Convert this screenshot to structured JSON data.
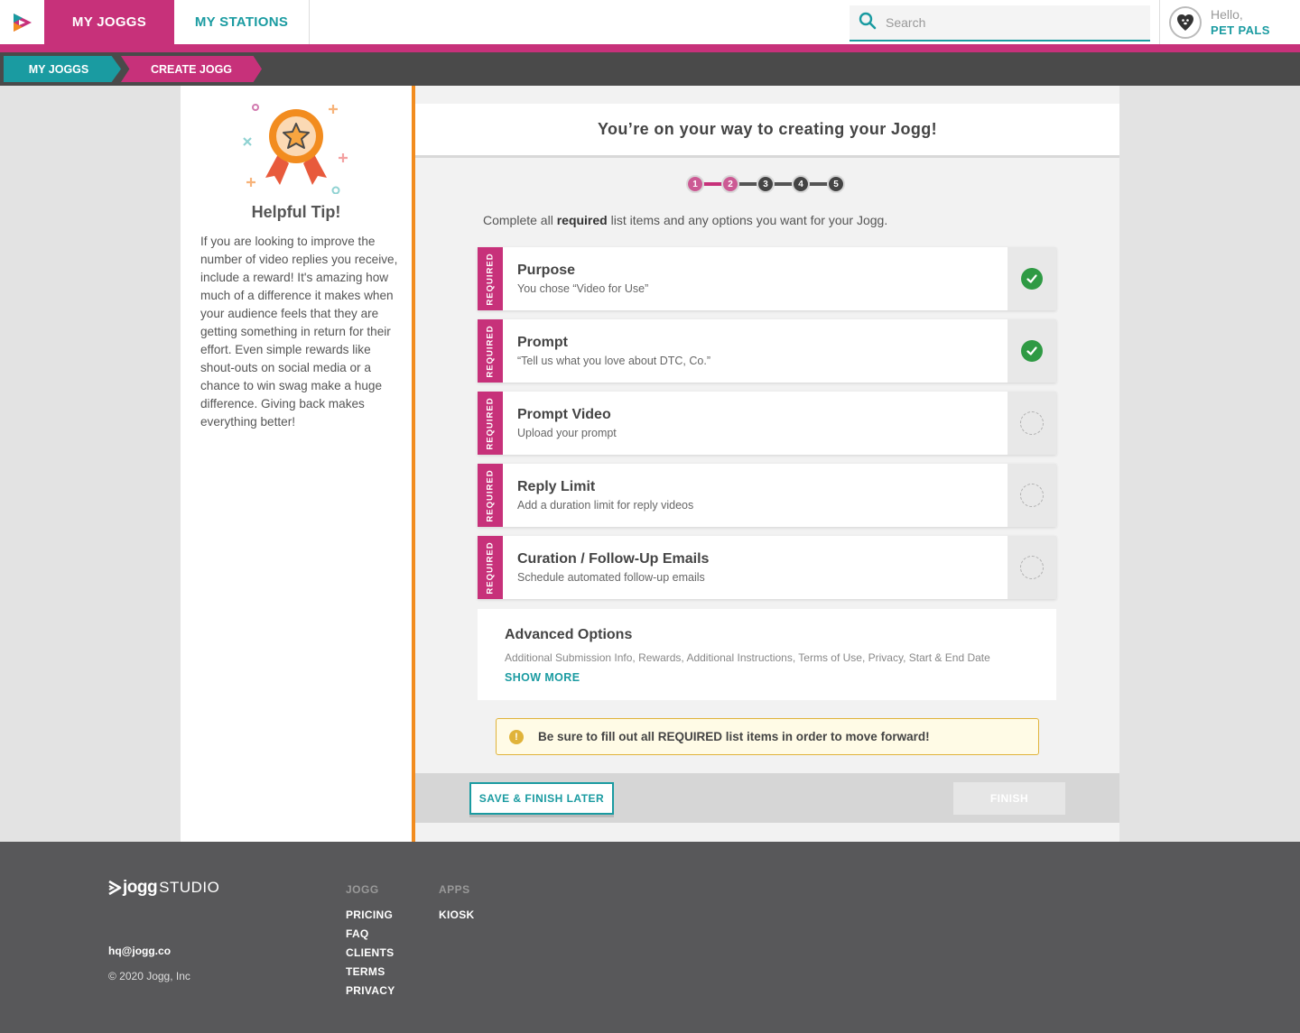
{
  "nav": {
    "tabs": [
      {
        "label": "MY JOGGS",
        "active": true
      },
      {
        "label": "MY STATIONS",
        "active": false
      }
    ],
    "search_placeholder": "Search",
    "user": {
      "greeting": "Hello,",
      "name": "PET PALS"
    }
  },
  "breadcrumb": [
    "MY JOGGS",
    "CREATE JOGG"
  ],
  "tip": {
    "title": "Helpful Tip!",
    "body": "If you are looking to improve the number of video replies you receive, include a reward! It's amazing how much of a difference it makes when your audience feels that they are getting something in return for their effort. Even simple rewards like shout-outs on social media or a chance to win swag make a huge difference. Giving back makes everything better!"
  },
  "main": {
    "header": "You’re on your way to creating your Jogg!",
    "steps": {
      "labels": [
        "1",
        "2",
        "3",
        "4",
        "5"
      ],
      "completed": 2
    },
    "instruction_pre": "Complete all ",
    "instruction_bold": "required",
    "instruction_post": " list items and any options you want for your Jogg.",
    "required_label": "REQUIRED",
    "items": [
      {
        "title": "Purpose",
        "subtitle": "You chose “Video for Use”",
        "complete": true
      },
      {
        "title": "Prompt",
        "subtitle": "“Tell us what you love about DTC, Co.”",
        "complete": true
      },
      {
        "title": "Prompt Video",
        "subtitle": "Upload your prompt",
        "complete": false
      },
      {
        "title": "Reply Limit",
        "subtitle": "Add a duration limit for reply videos",
        "complete": false
      },
      {
        "title": "Curation / Follow-Up Emails",
        "subtitle": "Schedule automated follow-up emails",
        "complete": false
      }
    ],
    "advanced": {
      "title": "Advanced Options",
      "subtitle": "Additional Submission Info, Rewards, Additional Instructions, Terms of Use, Privacy, Start & End Date",
      "show_more": "SHOW MORE"
    },
    "warning": {
      "icon": "!",
      "pre": "Be sure to fill out all ",
      "bold": "REQUIRED",
      "post": " list items in order to move forward!"
    },
    "buttons": {
      "save": "SAVE & FINISH LATER",
      "finish": "FINISH"
    }
  },
  "footer": {
    "logo_text": "jogg",
    "logo_suffix": "STUDIO",
    "email": "hq@jogg.co",
    "copyright": "© 2020 Jogg, Inc",
    "columns": [
      {
        "heading": "JOGG",
        "links": [
          "PRICING",
          "FAQ",
          "CLIENTS",
          "TERMS",
          "PRIVACY"
        ]
      },
      {
        "heading": "APPS",
        "links": [
          "KIOSK"
        ]
      }
    ]
  },
  "colors": {
    "brand_pink": "#c7317a",
    "brand_teal": "#1a9ba1",
    "tip_orange": "#f28c1f",
    "success": "#2f9a44",
    "warning": "#e0b33a"
  },
  "icons": [
    "jogg-logo-icon",
    "search-icon",
    "dog-avatar-icon",
    "award-ribbon-icon",
    "check-icon",
    "warning-icon"
  ]
}
